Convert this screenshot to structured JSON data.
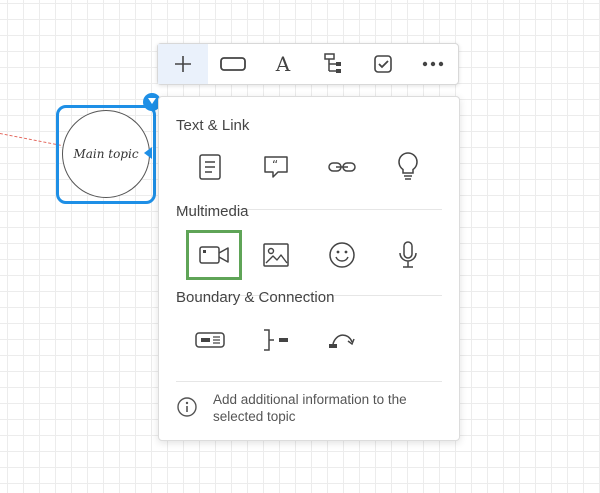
{
  "canvas": {
    "topic": {
      "label": "Main topic"
    }
  },
  "toolbar": {
    "buttons": [
      {
        "name": "add",
        "icon": "plus-icon",
        "active": true
      },
      {
        "name": "shape",
        "icon": "rectangle-icon"
      },
      {
        "name": "text",
        "icon": "text-icon",
        "glyph": "A"
      },
      {
        "name": "structure",
        "icon": "tree-structure-icon"
      },
      {
        "name": "task",
        "icon": "checkbox-icon"
      },
      {
        "name": "more",
        "icon": "more-icon"
      }
    ]
  },
  "panel": {
    "sections": [
      {
        "title": "Text & Link",
        "items": [
          "note-icon",
          "comment-icon",
          "link-icon",
          "idea-icon"
        ]
      },
      {
        "title": "Multimedia",
        "items": [
          "video-icon",
          "image-icon",
          "emoji-icon",
          "audio-icon"
        ],
        "selected": "video-icon"
      },
      {
        "title": "Boundary & Connection",
        "items": [
          "boundary-icon",
          "summary-icon",
          "relationship-icon"
        ]
      }
    ],
    "info_text": "Add additional information to the selected topic"
  },
  "colors": {
    "selection": "#1e8fe6",
    "highlight": "#5fa457",
    "connector": "#e3655b"
  }
}
